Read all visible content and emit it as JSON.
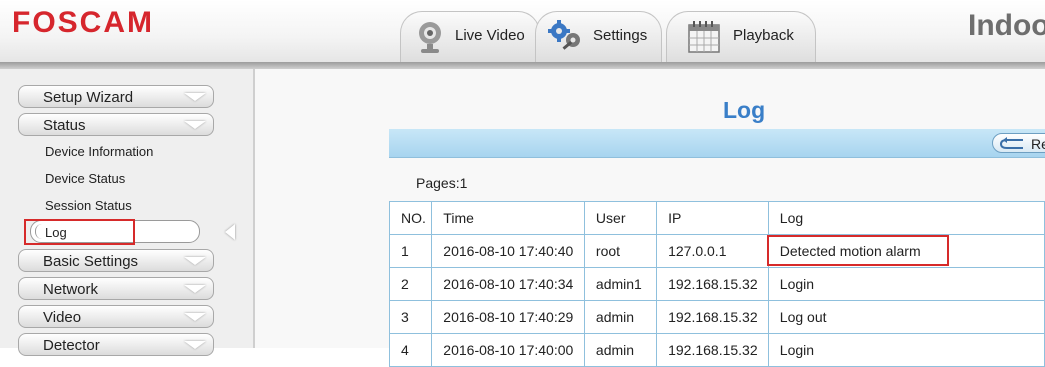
{
  "header": {
    "logo": "FOSCAM",
    "brand_right": "Indoo",
    "tabs": [
      {
        "label": "Live Video",
        "icon": "camera-icon"
      },
      {
        "label": "Settings",
        "icon": "gears-icon"
      },
      {
        "label": "Playback",
        "icon": "calendar-icon"
      }
    ]
  },
  "sidebar": {
    "items": [
      {
        "label": "Setup Wizard"
      },
      {
        "label": "Status"
      },
      {
        "label": "Basic Settings"
      },
      {
        "label": "Network"
      },
      {
        "label": "Video"
      },
      {
        "label": "Detector"
      }
    ],
    "status_subitems": [
      "Device Information",
      "Device Status",
      "Session Status",
      "Log"
    ]
  },
  "main": {
    "title": "Log",
    "refresh_label": "Re",
    "pages_label": "Pages:1",
    "table": {
      "columns": [
        "NO.",
        "Time",
        "User",
        "IP",
        "Log"
      ],
      "rows": [
        [
          "1",
          "2016-08-10 17:40:40",
          "root",
          "127.0.0.1",
          "Detected motion alarm"
        ],
        [
          "2",
          "2016-08-10 17:40:34",
          "admin1",
          "192.168.15.32",
          "Login"
        ],
        [
          "3",
          "2016-08-10 17:40:29",
          "admin",
          "192.168.15.32",
          "Log out"
        ],
        [
          "4",
          "2016-08-10 17:40:00",
          "admin",
          "192.168.15.32",
          "Login"
        ]
      ]
    }
  },
  "colors": {
    "brand_red": "#d6262d",
    "title_blue": "#3a7fc8",
    "highlight_red": "#d62a2a",
    "toolbar_blue": "#b5dcf2"
  }
}
